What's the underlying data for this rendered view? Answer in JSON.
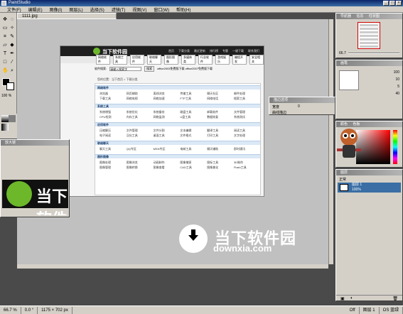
{
  "app": {
    "title": "PaintStudio"
  },
  "menu": [
    "文件(F)",
    "编辑(E)",
    "图像(I)",
    "图层(L)",
    "选择(S)",
    "滤镜(T)",
    "视图(V)",
    "窗口(W)",
    "帮助(H)"
  ],
  "document": {
    "tab": "1111.jpg"
  },
  "website": {
    "logo_text": "当下软件园",
    "header_links": [
      "首页",
      "下载分类",
      "最近更新",
      "排行榜",
      "专题",
      "一键下载",
      "联系我们"
    ],
    "nav_tabs": [
      "网络软件",
      "系统工具",
      "应用软件",
      "联络聊天",
      "图形图像",
      "多媒体类",
      "行业软件",
      "游戏娱乐",
      "编程开发",
      "安全相关"
    ],
    "search_label": "软件搜索:",
    "search_value": "请输入搜索字",
    "search_button": "搜索",
    "hot": "office2003免费版下载 office2007免费版下载",
    "breadcrumb": "您的位置：当下首页 > 下载分类",
    "sections": [
      {
        "title": "网络软件",
        "rows": [
          [
            "浏览器",
            "网页辅助",
            "离线浏览",
            "传输工具",
            "聊天社区",
            "邮件处理"
          ],
          [
            "下载工具",
            "网络电视",
            "网络加速",
            "FTP工具",
            "网络电话",
            "搜索工具"
          ]
        ]
      },
      {
        "title": "系统工具",
        "rows": [
          [
            "系统增强",
            "系统优化",
            "系统备份",
            "磁盘工具",
            "卸载软件",
            "文件管理"
          ],
          [
            "CPU检测",
            "内存工具",
            "网络监测",
            "U盘工具",
            "数据恢复",
            "系统测试"
          ]
        ]
      },
      {
        "title": "应用软件",
        "rows": [
          [
            "压缩解压",
            "文件管理",
            "文件分割",
            "文本编辑",
            "翻译工具",
            "阅读工具"
          ],
          [
            "电子阅读",
            "汉化工具",
            "桌面工具",
            "文件格式",
            "打印工具",
            "文字处理"
          ]
        ]
      },
      {
        "title": "联络聊天",
        "rows": [
          [
            "聊天工具",
            "QQ专区",
            "MSN专区",
            "电邮工具",
            "聊天辅助",
            "即时通讯"
          ]
        ]
      },
      {
        "title": "图形图像",
        "rows": [
          [
            "图像处理",
            "图像浏览",
            "动画制作",
            "图像捕捉",
            "图标工具",
            "3D制作"
          ],
          [
            "图像管理",
            "图像转换",
            "图像查看",
            "CAD工具",
            "图像美化",
            "Flash工具"
          ]
        ]
      }
    ]
  },
  "watermark": {
    "title": "当下软件园",
    "url": "downxia.com"
  },
  "panels": {
    "navigator": {
      "title": "导航器",
      "tab2": "信息",
      "tab3": "柱状图",
      "zoom": "66.7"
    },
    "brushes": {
      "title": "画笔",
      "values": [
        "100",
        "10",
        "5",
        "40"
      ]
    },
    "colors": {
      "title": "颜色",
      "tab2": "色板"
    },
    "layers": {
      "title": "图层",
      "mode": "正常",
      "layer_name": "图层 1",
      "opacity": "100%"
    },
    "layer_effects": {
      "title": "描边选项",
      "label": "宽度",
      "value": "0",
      "check": "曲线描边"
    },
    "small": {
      "title": "放大镜"
    }
  },
  "status": {
    "zoom": "66.7 %",
    "angle": "0.0 °",
    "size": "1175 × 702 px",
    "right1": "Off",
    "right2": "图层 1",
    "right3": "OS 蓝绿"
  }
}
